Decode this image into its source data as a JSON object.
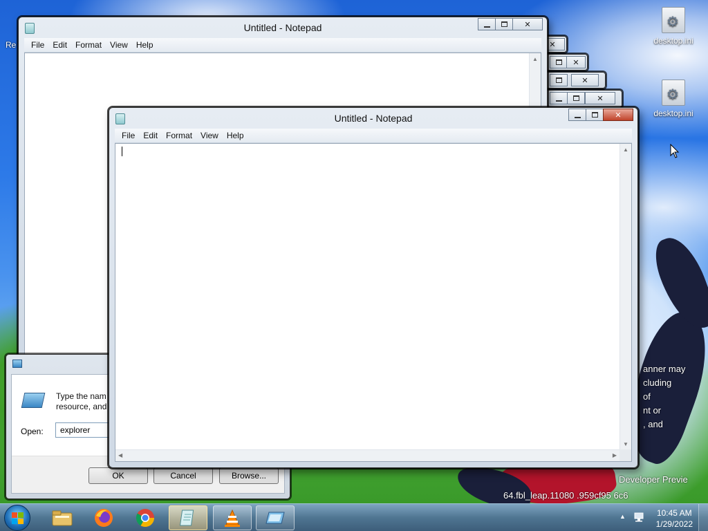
{
  "desktop": {
    "icons": [
      {
        "label": "desktop.ini"
      },
      {
        "label": "desktop.ini"
      }
    ],
    "left_edge_text": "Re",
    "wallpaper_text": {
      "line1": "anner may",
      "line2": "cluding",
      "line3": "of",
      "line4": "nt or",
      "line5": ", and",
      "developer": "Developer Previe",
      "build": "64.fbl_leap.11080 .959cf95 6c6"
    }
  },
  "notepad_back": {
    "title": "Untitled - Notepad",
    "menu": [
      "File",
      "Edit",
      "Format",
      "View",
      "Help"
    ]
  },
  "notepad_front": {
    "title": "Untitled - Notepad",
    "menu": [
      "File",
      "Edit",
      "Format",
      "View",
      "Help"
    ],
    "content": ""
  },
  "run_dialog": {
    "description_line1": "Type the nam",
    "description_line2": "resource, and",
    "open_label": "Open:",
    "open_value": "explorer",
    "buttons": [
      "OK",
      "Cancel",
      "Browse..."
    ]
  },
  "taskbar": {
    "pinned": [
      "windows-explorer",
      "firefox",
      "chrome",
      "notepad",
      "vlc",
      "run"
    ],
    "clock_time": "10:45 AM",
    "clock_date": "1/29/2022"
  },
  "colors": {
    "close_active": "#c0432a",
    "taskbar": "#466e8c"
  }
}
